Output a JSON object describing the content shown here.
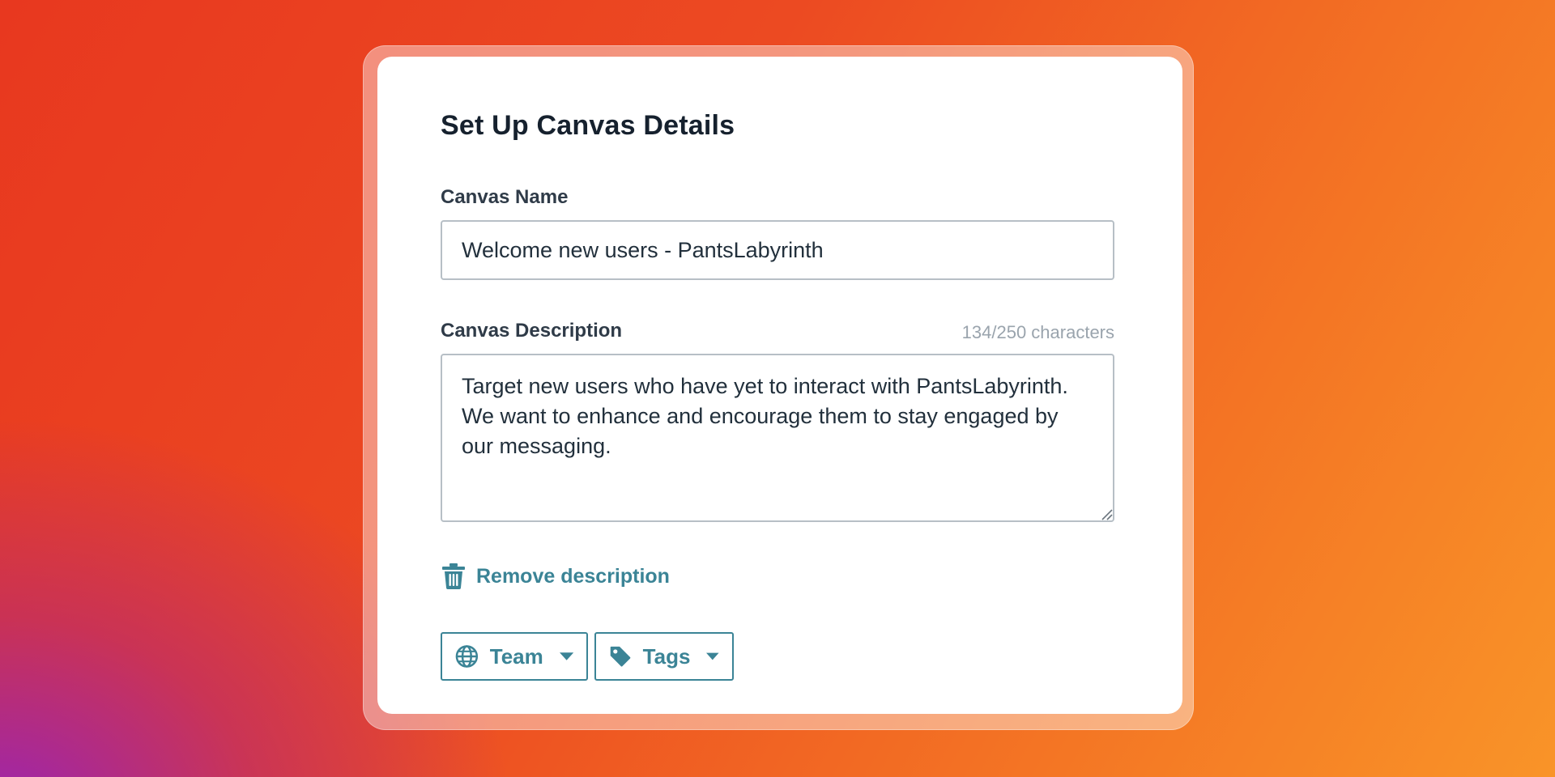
{
  "colors": {
    "accent": "#3b8496",
    "heading": "#16212e",
    "label": "#2f3b48",
    "muted": "#9aa4ad",
    "border": "#b7bfc6"
  },
  "card": {
    "title": "Set Up Canvas Details"
  },
  "name_field": {
    "label": "Canvas Name",
    "value": "Welcome new users - PantsLabyrinth"
  },
  "description_field": {
    "label": "Canvas Description",
    "counter": "134/250 characters",
    "value": "Target new users who have yet to interact with PantsLabyrinth. We want to enhance and encourage them to stay engaged by our messaging."
  },
  "remove_description": {
    "label": "Remove description",
    "icon": "trash-icon"
  },
  "dropdowns": {
    "team": {
      "label": "Team",
      "icon": "globe-icon"
    },
    "tags": {
      "label": "Tags",
      "icon": "tag-icon"
    }
  }
}
